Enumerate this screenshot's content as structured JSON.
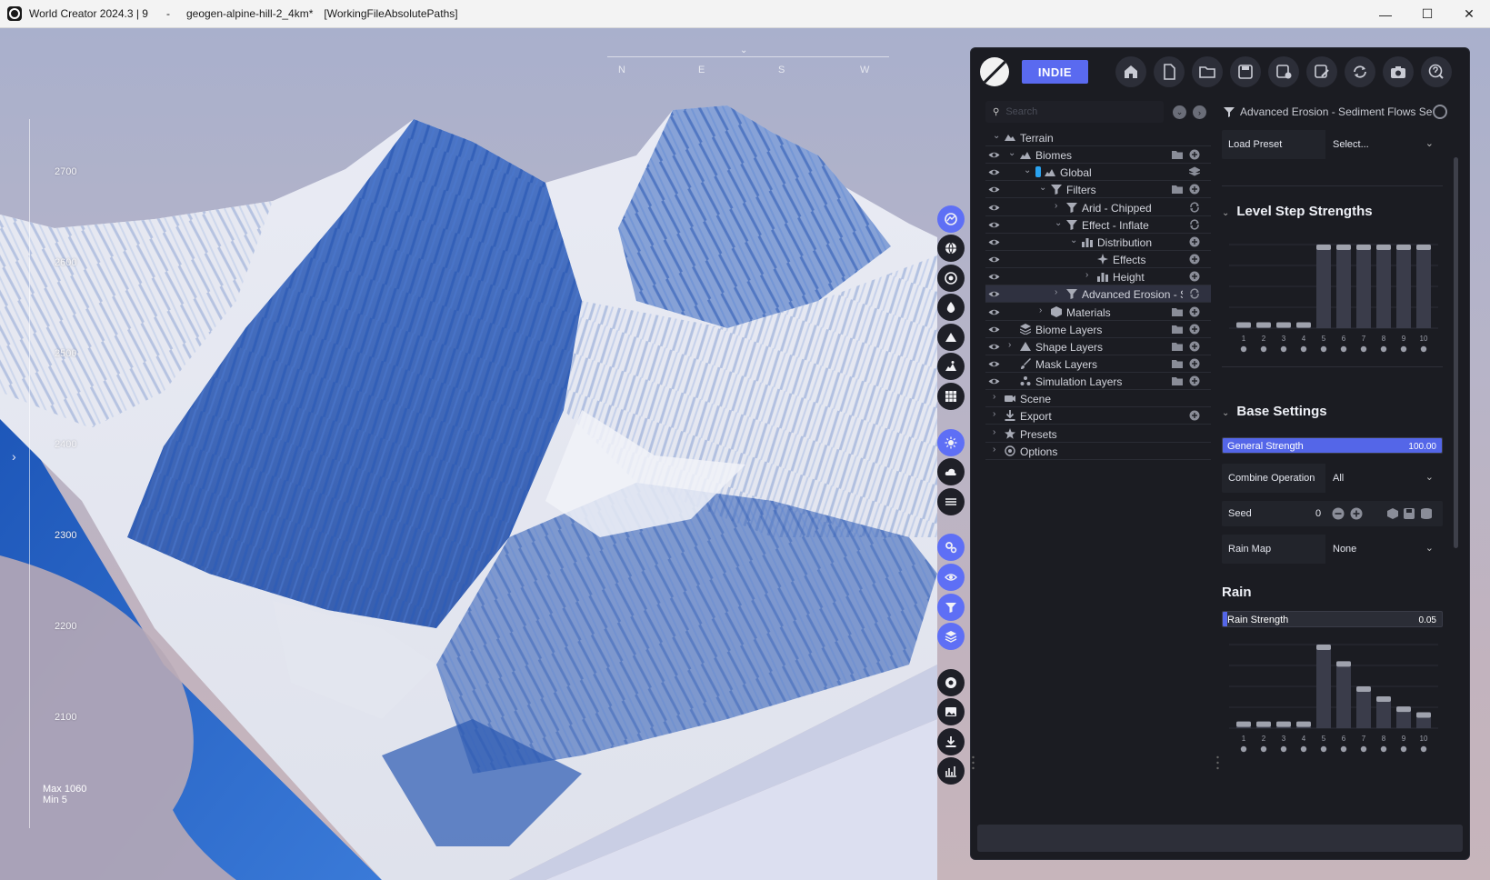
{
  "window": {
    "app": "World Creator 2024.3 | 9",
    "separator": "-",
    "file": "geogen-alpine-hill-2_4km*",
    "mode": "[WorkingFileAbsolutePaths]",
    "controls": {
      "minimize": "—",
      "maximize": "☐",
      "close": "✕"
    }
  },
  "viewport": {
    "compass": [
      "N",
      "E",
      "S",
      "W"
    ],
    "compass_marker": "⌄",
    "scale_labels": [
      "2700",
      "2600",
      "2500",
      "2400",
      "2300",
      "2200",
      "2100"
    ],
    "max_label": "Max 1060",
    "min_label": "Min 5",
    "expand_arrow": "›"
  },
  "vtoolbar": [
    {
      "icon": "terrain-globe-icon",
      "active": true
    },
    {
      "icon": "globe-icon",
      "active": false
    },
    {
      "icon": "compass-icon",
      "active": false
    },
    {
      "icon": "water-drop-icon",
      "active": false
    },
    {
      "icon": "mountain-icon",
      "active": false
    },
    {
      "icon": "biome-icon",
      "active": false
    },
    {
      "icon": "grid-icon",
      "active": false
    },
    {
      "icon": "sun-icon",
      "active": true
    },
    {
      "icon": "cloud-icon",
      "active": false
    },
    {
      "icon": "fog-icon",
      "active": false
    },
    {
      "icon": "settings-icon",
      "active": true
    },
    {
      "icon": "eye-icon",
      "active": true
    },
    {
      "icon": "filter-icon",
      "active": true
    },
    {
      "icon": "layers-icon",
      "active": true
    },
    {
      "icon": "record-icon",
      "active": false
    },
    {
      "icon": "image-icon",
      "active": false
    },
    {
      "icon": "download-icon",
      "active": false
    },
    {
      "icon": "stats-icon",
      "active": false
    }
  ],
  "panel": {
    "badge": "INDIE",
    "toolbar": [
      "home-icon",
      "new-file-icon",
      "open-folder-icon",
      "save-icon",
      "save-as-icon",
      "edit-icon",
      "sync-icon",
      "camera-icon",
      "help-icon"
    ],
    "search": {
      "placeholder": "Search",
      "value": ""
    },
    "tree": [
      {
        "label": "Terrain",
        "indent": 0,
        "eye": false,
        "chev": "v",
        "icon": "terrain",
        "a1": "",
        "a2": ""
      },
      {
        "label": "Biomes",
        "indent": 1,
        "eye": true,
        "chev": "v",
        "icon": "biome",
        "a1": "folder",
        "a2": "plus"
      },
      {
        "label": "Global",
        "indent": 2,
        "eye": true,
        "chev": "v",
        "icon": "biome",
        "color": "#2aa3f0",
        "a1": "",
        "a2": "stack"
      },
      {
        "label": "Filters",
        "indent": 3,
        "eye": true,
        "chev": "v",
        "icon": "filter",
        "a1": "folder",
        "a2": "plus"
      },
      {
        "label": "Arid - Chipped",
        "indent": 4,
        "eye": true,
        "chev": ">",
        "icon": "filter",
        "a1": "",
        "a2": "sync"
      },
      {
        "label": "Effect - Inflate",
        "indent": 4,
        "eye": true,
        "chev": "v",
        "icon": "filter",
        "a1": "",
        "a2": "sync"
      },
      {
        "label": "Distribution",
        "indent": 5,
        "eye": true,
        "chev": "v",
        "icon": "dist",
        "a1": "",
        "a2": "plus"
      },
      {
        "label": "Effects",
        "indent": 6,
        "eye": true,
        "chev": "",
        "icon": "fx",
        "a1": "",
        "a2": "plus"
      },
      {
        "label": "Height",
        "indent": 6,
        "eye": true,
        "chev": ">",
        "icon": "dist",
        "a1": "",
        "a2": "plus"
      },
      {
        "label": "Advanced Erosion - Se",
        "indent": 4,
        "eye": true,
        "chev": ">",
        "icon": "filter",
        "a1": "",
        "a2": "sync",
        "selected": true
      },
      {
        "label": "Materials",
        "indent": 3,
        "eye": true,
        "chev": ">",
        "icon": "cube",
        "a1": "folder",
        "a2": "plus"
      },
      {
        "label": "Biome Layers",
        "indent": 1,
        "eye": true,
        "chev": "",
        "icon": "layers",
        "a1": "folder",
        "a2": "plus"
      },
      {
        "label": "Shape Layers",
        "indent": 1,
        "eye": true,
        "chev": ">",
        "icon": "mountain",
        "a1": "folder",
        "a2": "plus"
      },
      {
        "label": "Mask Layers",
        "indent": 1,
        "eye": true,
        "chev": "",
        "icon": "brush",
        "a1": "folder",
        "a2": "plus"
      },
      {
        "label": "Simulation Layers",
        "indent": 1,
        "eye": true,
        "chev": "",
        "icon": "sim",
        "a1": "folder",
        "a2": "plus"
      },
      {
        "label": "Scene",
        "indent": 0,
        "eye": false,
        "chev": ">",
        "icon": "camera",
        "a1": "",
        "a2": ""
      },
      {
        "label": "Export",
        "indent": 0,
        "eye": false,
        "chev": ">",
        "icon": "export",
        "a1": "",
        "a2": "plus"
      },
      {
        "label": "Presets",
        "indent": 0,
        "eye": false,
        "chev": ">",
        "icon": "star",
        "a1": "",
        "a2": ""
      },
      {
        "label": "Options",
        "indent": 0,
        "eye": false,
        "chev": ">",
        "icon": "gear",
        "a1": "",
        "a2": ""
      }
    ],
    "props": {
      "title": "Advanced Erosion - Sediment Flows Se",
      "load_preset_label": "Load Preset",
      "load_preset_value": "Select...",
      "level_step_title": "Level Step Strengths",
      "level_steps": [
        0.07,
        0.07,
        0.07,
        0.07,
        1.0,
        1.0,
        1.0,
        1.0,
        1.0,
        1.0
      ],
      "level_step_labels": [
        "1",
        "2",
        "3",
        "4",
        "5",
        "6",
        "7",
        "8",
        "9",
        "10"
      ],
      "base_title": "Base Settings",
      "general_strength_label": "General Strength",
      "general_strength_value": "100.00",
      "general_strength_fraction": 1.0,
      "combine_label": "Combine Operation",
      "combine_value": "All",
      "seed_label": "Seed",
      "seed_value": "0",
      "rain_map_label": "Rain Map",
      "rain_map_value": "None",
      "rain_title": "Rain",
      "rain_strength_label": "Rain Strength",
      "rain_strength_value": "0.05",
      "rain_strength_fraction": 0.02,
      "rain_steps": [
        0.08,
        0.08,
        0.08,
        0.08,
        1.0,
        0.8,
        0.5,
        0.38,
        0.26,
        0.19
      ],
      "rain_step_labels": [
        "1",
        "2",
        "3",
        "4",
        "5",
        "6",
        "7",
        "8",
        "9",
        "10"
      ]
    }
  },
  "colors": {
    "accent": "#5a6af0",
    "panel_bg": "#1b1c22",
    "snow": "#eef0f6",
    "rock_blue": "#2f5db3"
  }
}
